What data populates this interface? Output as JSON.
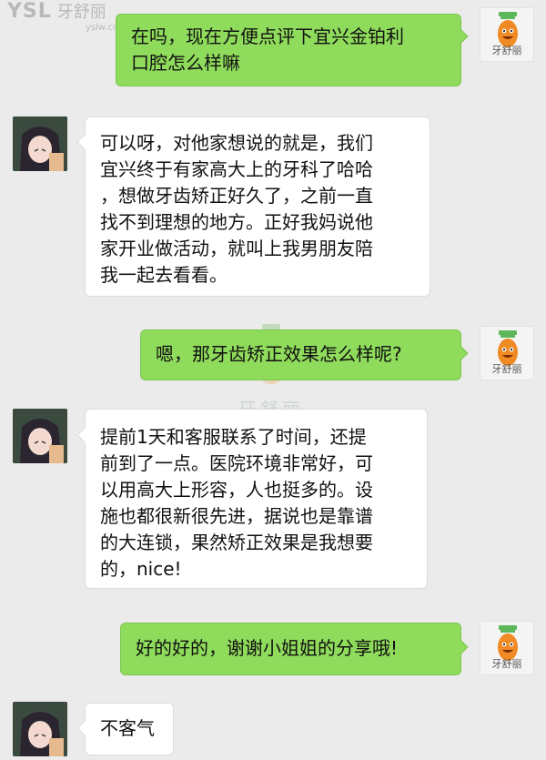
{
  "watermark": {
    "brand": "YSL",
    "brand_cn": "牙舒丽",
    "url": "yslw.com",
    "center_text": "牙舒丽"
  },
  "brand_avatar": {
    "caption": "牙舒丽",
    "accent": "#f08a24"
  },
  "messages": [
    {
      "sender": "brand",
      "lines": [
        "在吗，现在方便点评下宜兴金铂利",
        "口腔怎么样嘛"
      ]
    },
    {
      "sender": "user",
      "lines": [
        "可以呀，对他家想说的就是，我们",
        "宜兴终于有家高大上的牙科了哈哈",
        "，想做牙齿矫正好久了，之前一直",
        "找不到理想的地方。正好我妈说他",
        "家开业做活动，就叫上我男朋友陪",
        "我一起去看看。"
      ]
    },
    {
      "sender": "brand",
      "lines": [
        "嗯，那牙齿矫正效果怎么样呢?"
      ]
    },
    {
      "sender": "user",
      "lines": [
        "提前1天和客服联系了时间，还提",
        "前到了一点。医院环境非常好，可",
        "以用高大上形容，人也挺多的。设",
        "施也都很新很先进，据说也是靠谱",
        "的大连锁，果然矫正效果是我想要",
        "的，nice!"
      ]
    },
    {
      "sender": "brand",
      "lines": [
        "好的好的，谢谢小姐姐的分享哦!"
      ]
    },
    {
      "sender": "user",
      "lines": [
        "不客气"
      ]
    }
  ],
  "colors": {
    "outgoing": "#8fdb5b",
    "incoming": "#ffffff",
    "background": "#ebebeb"
  }
}
